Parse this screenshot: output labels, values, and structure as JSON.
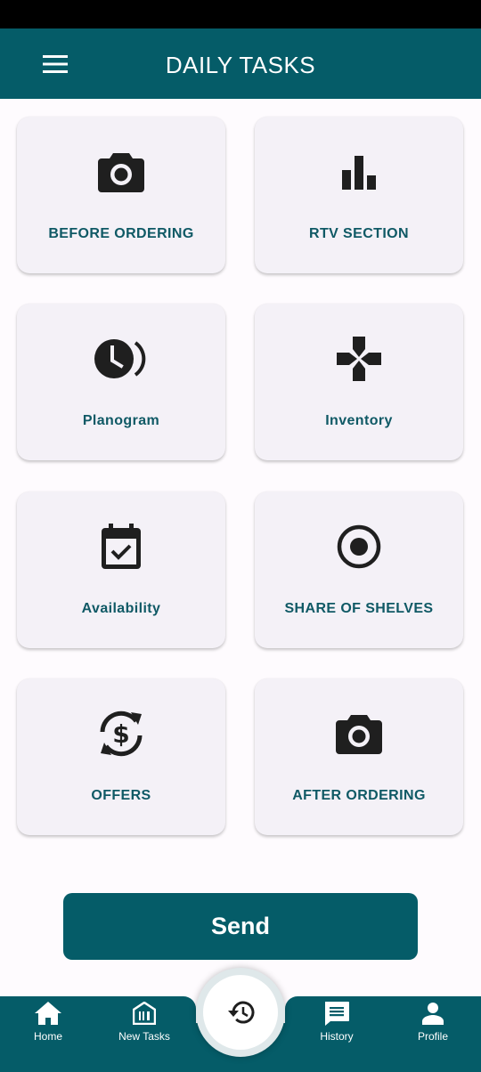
{
  "app_bar": {
    "title": "DAILY TASKS"
  },
  "tasks": [
    {
      "label": "BEFORE ORDERING",
      "icon": "camera-icon"
    },
    {
      "label": "RTV SECTION",
      "icon": "bar-chart-icon"
    },
    {
      "label": "Planogram",
      "icon": "clock-icon"
    },
    {
      "label": "Inventory",
      "icon": "gamepad-icon"
    },
    {
      "label": "Availability",
      "icon": "calendar-check-icon"
    },
    {
      "label": "SHARE OF SHELVES",
      "icon": "radio-button-icon"
    },
    {
      "label": "OFFERS",
      "icon": "currency-exchange-icon"
    },
    {
      "label": "AFTER ORDERING",
      "icon": "camera-icon"
    }
  ],
  "send_button": {
    "label": "Send"
  },
  "bottom_nav": {
    "items": [
      {
        "label": "Home",
        "icon": "home-icon"
      },
      {
        "label": "New Tasks",
        "icon": "store-icon"
      },
      {
        "label": "History",
        "icon": "history-message-icon"
      },
      {
        "label": "Profile",
        "icon": "person-icon"
      }
    ],
    "center_icon": "history-icon"
  },
  "colors": {
    "primary": "#055c68",
    "card_bg": "#f4f1f7",
    "label_text": "#0f5965",
    "icon": "#1f1f1f"
  }
}
